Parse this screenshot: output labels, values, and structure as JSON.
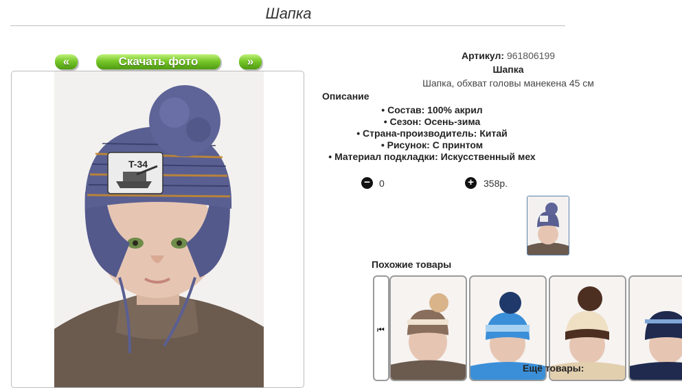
{
  "page": {
    "title": "Шапка"
  },
  "photo_nav": {
    "prev": "«",
    "download": "Скачать фото",
    "next": "»"
  },
  "product": {
    "article_label": "Артикул:",
    "article_value": "961806199",
    "name": "Шапка",
    "short_description": "Шапка, обхват головы манекена 45 см"
  },
  "description": {
    "heading": "Описание",
    "items": [
      "Состав: 100% акрил",
      "Сезон: Осень-зима",
      "Страна-производитель: Китай",
      "Рисунок: С принтом",
      "Материал подкладки: Искусственный мех"
    ]
  },
  "order": {
    "quantity": "0",
    "price": "358р.",
    "minus_icon": "minus-circle-icon",
    "plus_icon": "plus-circle-icon"
  },
  "similar": {
    "heading": "Похожие товары",
    "prev_icon": "skip-back-icon",
    "more": "Ещё товары:",
    "colors": [
      "#8a6e5c",
      "#3b8fd8",
      "#4d2f22",
      "#1f2a4e"
    ]
  },
  "colors": {
    "button_green": "#6cbd22",
    "hat_blue": "#5a5f92",
    "hat_orange": "#c98a2b"
  }
}
